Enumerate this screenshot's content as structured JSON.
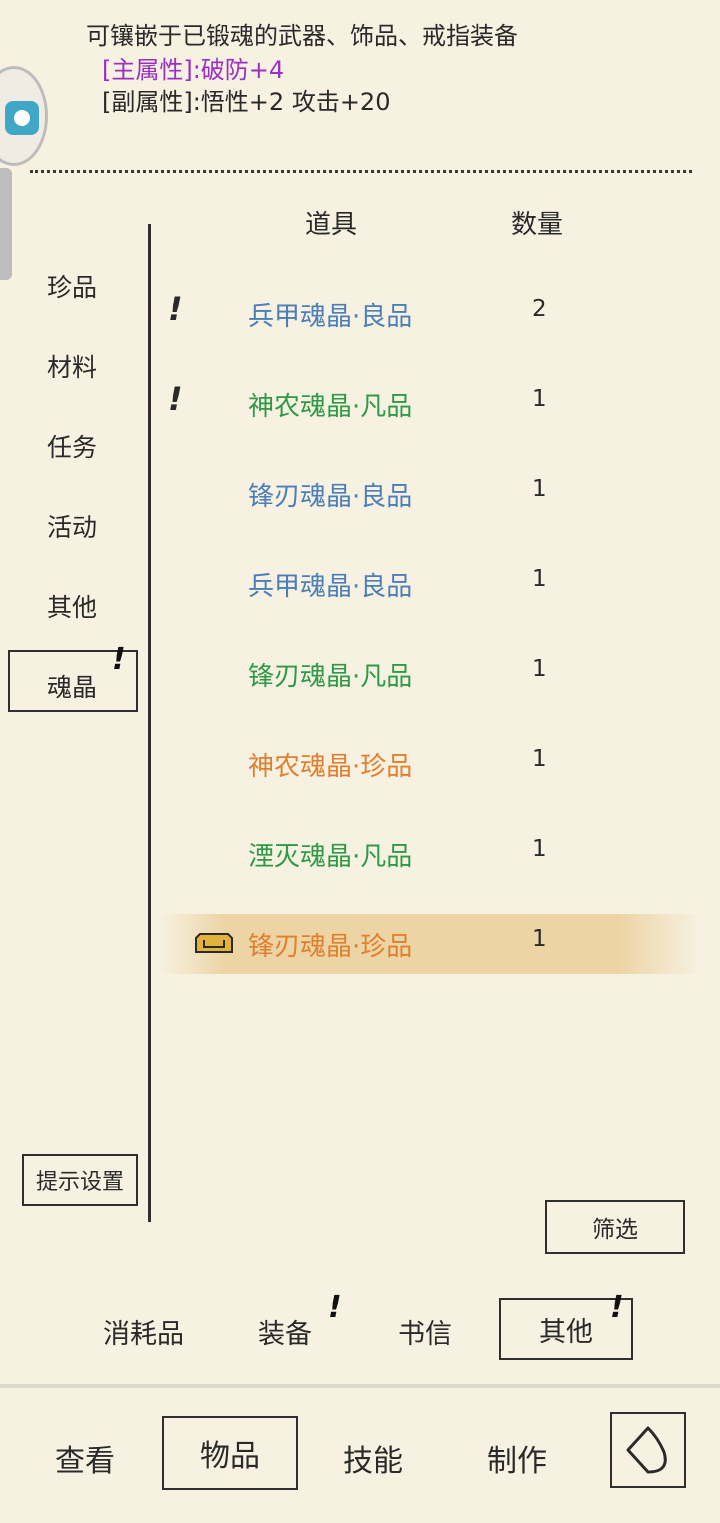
{
  "description": {
    "text": "可镶嵌于已锻魂的武器、饰品、戒指装备",
    "main_attr": "[主属性]:破防+4",
    "sub_attr": "[副属性]:悟性+2 攻击+20"
  },
  "table_header": {
    "item": "道具",
    "quantity": "数量"
  },
  "categories": [
    "珍品",
    "材料",
    "任务",
    "活动",
    "其他",
    "魂晶"
  ],
  "selected_category": "魂晶",
  "alert_mark": "!",
  "items": [
    {
      "name": "兵甲魂晶·良品",
      "qty": "2",
      "color": "#4a7fb8",
      "alert": true
    },
    {
      "name": "神农魂晶·凡品",
      "qty": "1",
      "color": "#2e9a48",
      "alert": true
    },
    {
      "name": "锋刃魂晶·良品",
      "qty": "1",
      "color": "#4a7fb8",
      "alert": false
    },
    {
      "name": "兵甲魂晶·良品",
      "qty": "1",
      "color": "#4a7fb8",
      "alert": false
    },
    {
      "name": "锋刃魂晶·凡品",
      "qty": "1",
      "color": "#2e9a48",
      "alert": false
    },
    {
      "name": "神农魂晶·珍品",
      "qty": "1",
      "color": "#e0802e",
      "alert": false
    },
    {
      "name": "湮灭魂晶·凡品",
      "qty": "1",
      "color": "#2e9a48",
      "alert": false
    },
    {
      "name": "锋刃魂晶·珍品",
      "qty": "1",
      "color": "#e0802e",
      "alert": false,
      "selected": true,
      "equipped": true
    }
  ],
  "buttons": {
    "hint_settings": "提示设置",
    "filter": "筛选"
  },
  "item_tabs": [
    "消耗品",
    "装备",
    "书信",
    "其他"
  ],
  "selected_item_tab": "其他",
  "nav": [
    "查看",
    "物品",
    "技能",
    "制作"
  ],
  "selected_nav": "物品"
}
